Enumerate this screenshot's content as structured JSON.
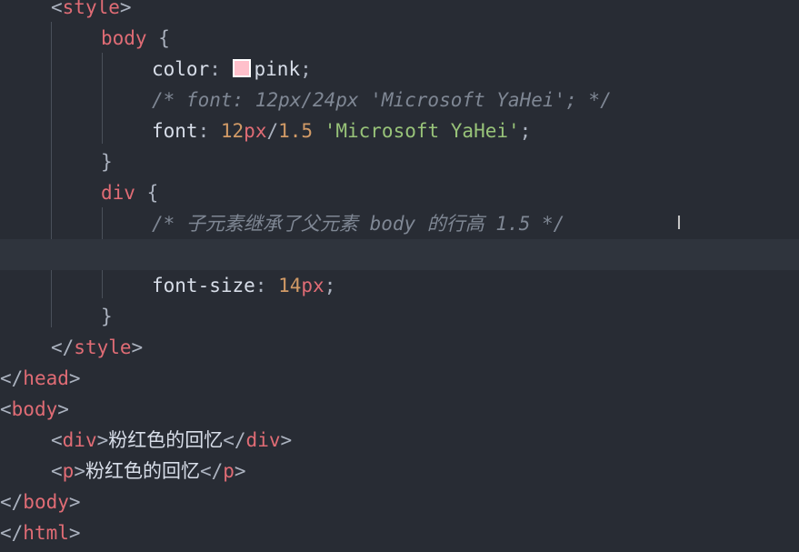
{
  "editor": {
    "lines": [
      {
        "t1": "<",
        "t2": "style",
        "t3": ">"
      },
      {
        "sel": "body",
        "brace": " {"
      },
      {
        "prop": "color",
        "colon": ": ",
        "val": "pink",
        "semi": ";"
      },
      {
        "comment": "/* font: 12px/24px 'Microsoft YaHei'; */"
      },
      {
        "prop": "font",
        "colon": ": ",
        "n1": "12",
        "u1": "px",
        "slash": "/",
        "n2": "1.5",
        "sp": " ",
        "str": "'Microsoft YaHei'",
        "semi": ";"
      },
      {
        "brace": "}"
      },
      {
        "sel": "div",
        "brace": " {"
      },
      {
        "comment": "/* 子元素继承了父元素 body 的行高 1.5 */"
      },
      {
        "empty": ""
      },
      {
        "prop": "font-size",
        "colon": ": ",
        "n1": "14",
        "u1": "px",
        "semi": ";"
      },
      {
        "brace": "}"
      },
      {
        "t1": "</",
        "t2": "style",
        "t3": ">"
      },
      {
        "t1": "</",
        "t2": "head",
        "t3": ">"
      },
      {
        "t1": "<",
        "t2": "body",
        "t3": ">"
      },
      {
        "t1": "<",
        "t2": "div",
        "t3": ">",
        "text": "粉红色的回忆",
        "t4": "</",
        "t5": "div",
        "t6": ">"
      },
      {
        "t1": "<",
        "t2": "p",
        "t3": ">",
        "text": "粉红色的回忆",
        "t4": "</",
        "t5": "p",
        "t6": ">"
      },
      {
        "t1": "</",
        "t2": "body",
        "t3": ">"
      },
      {
        "t1": "</",
        "t2": "html",
        "t3": ">"
      }
    ],
    "swatch_color": "#ffc0cb",
    "cursor_icon": "text-cursor-icon",
    "cursor_glyph": "I"
  }
}
